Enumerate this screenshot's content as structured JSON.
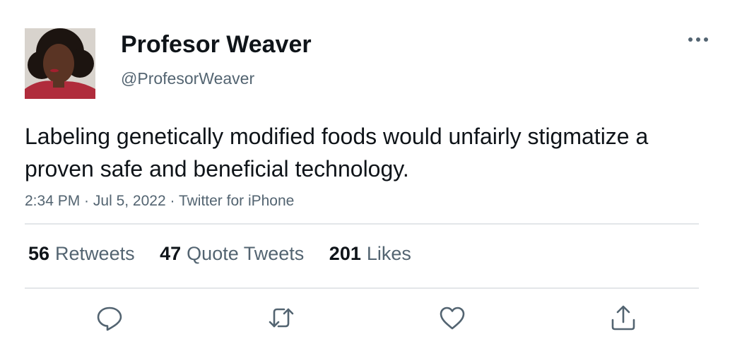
{
  "author": {
    "display_name": "Profesor Weaver",
    "handle": "@ProfesorWeaver",
    "avatar": "profile-photo"
  },
  "tweet": {
    "text": "Labeling genetically modified foods would unfairly stigmatize a proven safe and beneficial technology."
  },
  "meta": {
    "time": "2:34 PM",
    "separator": " · ",
    "date": "Jul 5, 2022",
    "source": "Twitter for iPhone"
  },
  "stats": {
    "retweets_count": "56",
    "retweets_label": "Retweets",
    "quotes_count": "47",
    "quotes_label": "Quote Tweets",
    "likes_count": "201",
    "likes_label": "Likes"
  },
  "actions": [
    "reply-icon",
    "retweet-icon",
    "like-icon",
    "share-icon"
  ],
  "colors": {
    "text_primary": "#0f1419",
    "text_secondary": "#536471",
    "divider": "#e3e6e9",
    "icon": "#536471"
  }
}
